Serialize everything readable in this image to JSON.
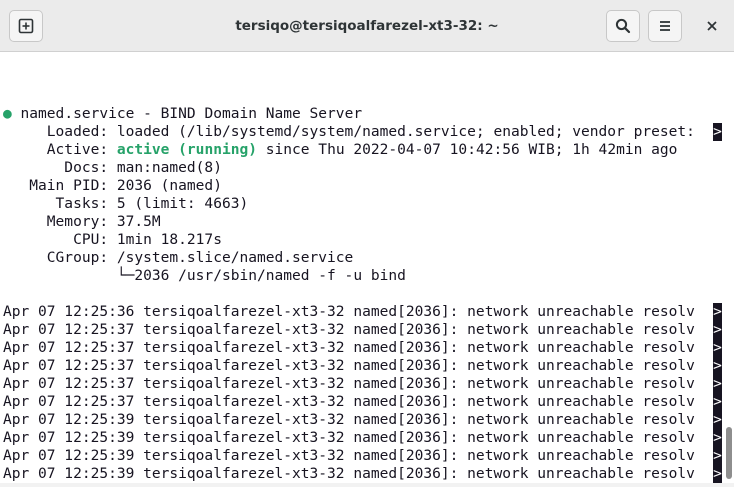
{
  "window": {
    "title": "tersiqo@tersiqoalfarezel-xt3-32: ~"
  },
  "header": {
    "new_tab_icon": "new-tab-icon",
    "search_icon": "search-icon",
    "menu_icon": "hamburger-menu-icon",
    "close_icon": "close-icon"
  },
  "status": {
    "bullet": "●",
    "service_line": " named.service - BIND Domain Name Server",
    "loaded": "     Loaded: loaded (/lib/systemd/system/named.service; enabled; vendor preset:",
    "active_label": "     Active: ",
    "active_state": "active (running)",
    "active_rest": " since Thu 2022-04-07 10:42:56 WIB; 1h 42min ago",
    "docs": "       Docs: man:named(8)",
    "main_pid": "   Main PID: 2036 (named)",
    "tasks": "      Tasks: 5 (limit: 4663)",
    "memory": "     Memory: 37.5M",
    "cpu": "        CPU: 1min 18.217s",
    "cgroup": "     CGroup: /system.slice/named.service",
    "cgroup_child": "             └─2036 /usr/sbin/named -f -u bind",
    "overflow_marker": ">"
  },
  "log_lines": [
    "Apr 07 12:25:36 tersiqoalfarezel-xt3-32 named[2036]: network unreachable resolv",
    "Apr 07 12:25:37 tersiqoalfarezel-xt3-32 named[2036]: network unreachable resolv",
    "Apr 07 12:25:37 tersiqoalfarezel-xt3-32 named[2036]: network unreachable resolv",
    "Apr 07 12:25:37 tersiqoalfarezel-xt3-32 named[2036]: network unreachable resolv",
    "Apr 07 12:25:37 tersiqoalfarezel-xt3-32 named[2036]: network unreachable resolv",
    "Apr 07 12:25:37 tersiqoalfarezel-xt3-32 named[2036]: network unreachable resolv",
    "Apr 07 12:25:39 tersiqoalfarezel-xt3-32 named[2036]: network unreachable resolv",
    "Apr 07 12:25:39 tersiqoalfarezel-xt3-32 named[2036]: network unreachable resolv",
    "Apr 07 12:25:39 tersiqoalfarezel-xt3-32 named[2036]: network unreachable resolv",
    "Apr 07 12:25:39 tersiqoalfarezel-xt3-32 named[2036]: network unreachable resolv"
  ],
  "colors": {
    "active_green": "#26a269",
    "terminal_fg": "#171421",
    "terminal_bg": "#ffffff",
    "titlebar_bg": "#ebebeb"
  }
}
